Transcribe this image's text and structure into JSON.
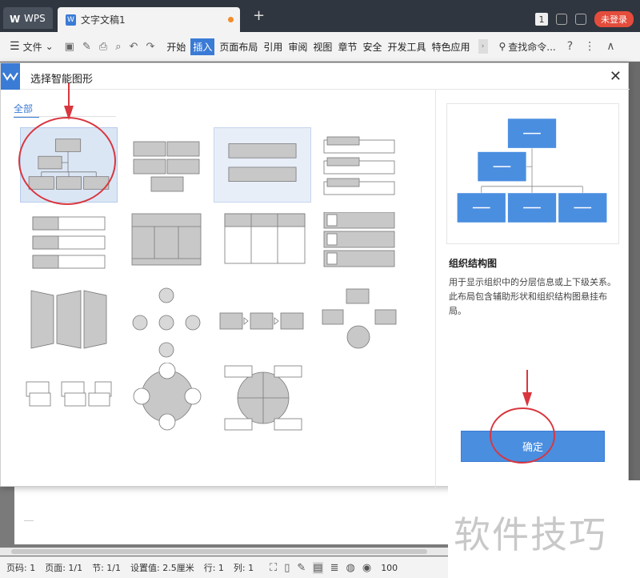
{
  "titlebar": {
    "app_tab": "WPS",
    "doc_tab": "文字文稿1",
    "new_tab": "+",
    "window_count": "1",
    "login": "未登录"
  },
  "menubar": {
    "file_menu": "文件",
    "tabs": [
      "开始",
      "插入",
      "页面布局",
      "引用",
      "审阅",
      "视图",
      "章节",
      "安全",
      "开发工具",
      "特色应用"
    ],
    "active_tab": "插入",
    "search": "查找命令...",
    "help": "?",
    "more": "⋮",
    "collapse": "∧"
  },
  "dialog": {
    "title": "选择智能图形",
    "close": "✕",
    "category": "全部",
    "preview_title": "组织结构图",
    "preview_desc": "用于显示组织中的分层信息或上下级关系。此布局包含辅助形状和组织结构图悬挂布局。",
    "ok_button": "确定"
  },
  "statusbar": {
    "page_num": "页码: 1",
    "pages": "页面: 1/1",
    "section": "节: 1/1",
    "setting": "设置值: 2.5厘米",
    "row": "行: 1",
    "col": "列: 1",
    "zoom": "100"
  },
  "watermark": "软件技巧",
  "colors": {
    "accent": "#3a7bd5",
    "annotation_red": "#d9363e",
    "shape_gray": "#c8c8c8",
    "preview_blue": "#4a8ee0"
  }
}
